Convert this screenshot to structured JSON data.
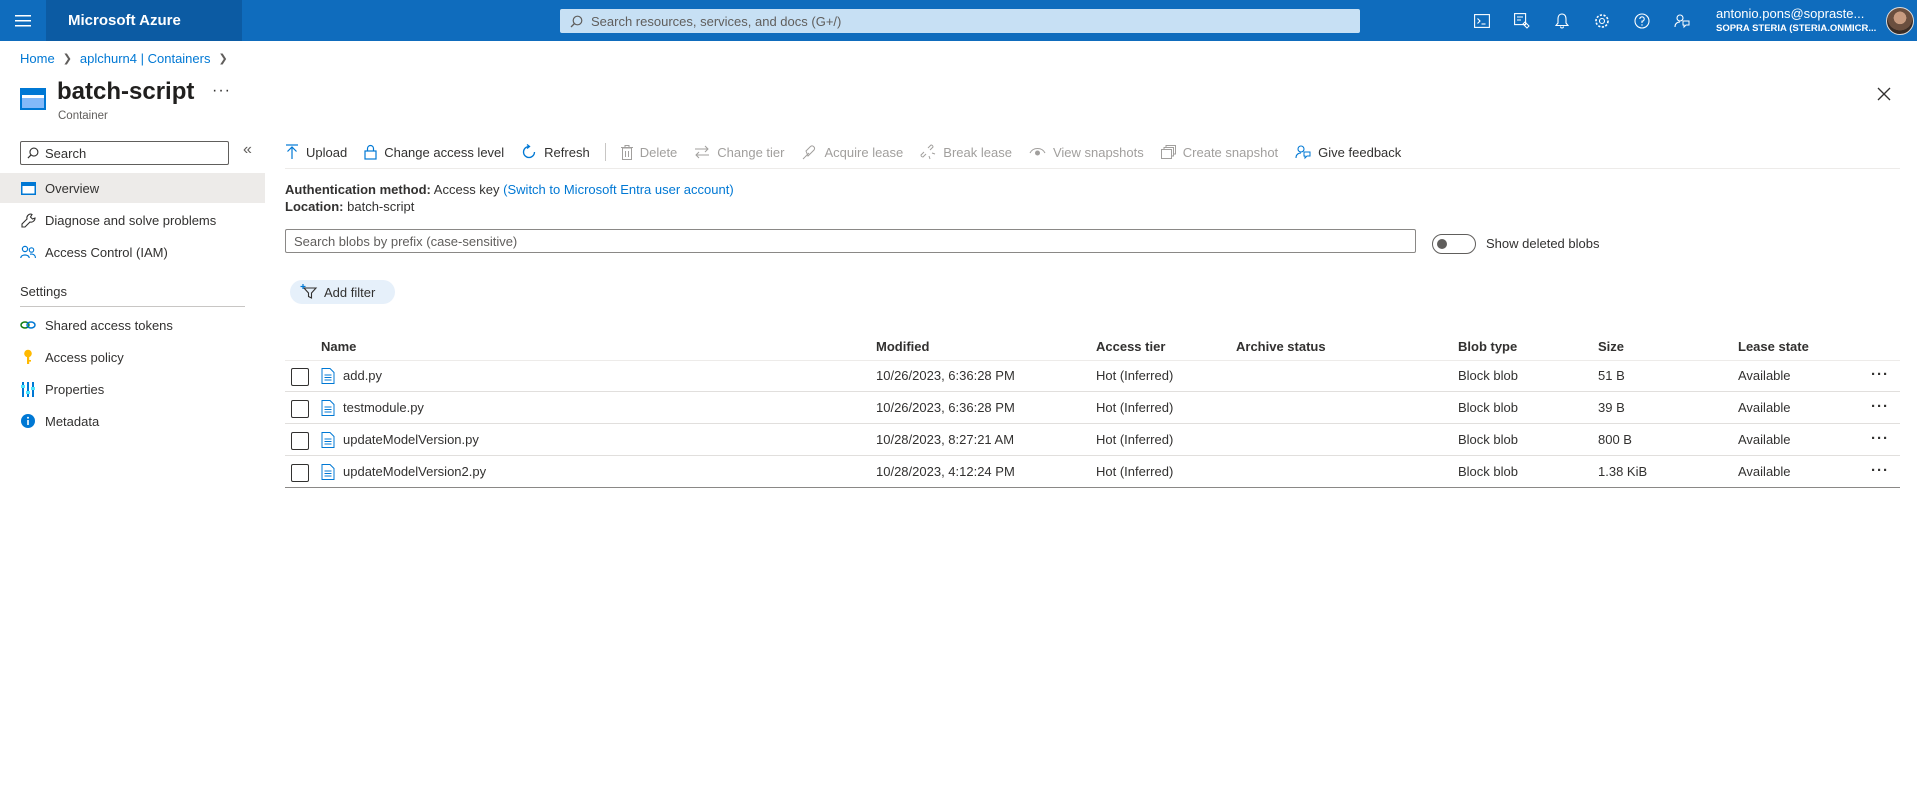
{
  "topbar": {
    "brand": "Microsoft Azure",
    "search_placeholder": "Search resources, services, and docs (G+/)",
    "account_name": "antonio.pons@sopraste...",
    "account_tenant": "SOPRA STERIA (STERIA.ONMICR...",
    "icons": [
      "cloud-shell-icon",
      "directory-subscription-icon",
      "notifications-icon",
      "settings-icon",
      "help-icon",
      "feedback-icon"
    ]
  },
  "breadcrumb": {
    "home": "Home",
    "parent": "aplchurn4 | Containers"
  },
  "page": {
    "title": "batch-script",
    "subtitle": "Container",
    "more": "···"
  },
  "nav": {
    "search_placeholder": "Search",
    "items": [
      {
        "label": "Overview"
      },
      {
        "label": "Diagnose and solve problems"
      },
      {
        "label": "Access Control (IAM)"
      }
    ],
    "settings_header": "Settings",
    "settings_items": [
      {
        "label": "Shared access tokens"
      },
      {
        "label": "Access policy"
      },
      {
        "label": "Properties"
      },
      {
        "label": "Metadata"
      }
    ]
  },
  "commands": {
    "upload": "Upload",
    "change_access": "Change access level",
    "refresh": "Refresh",
    "delete": "Delete",
    "change_tier": "Change tier",
    "acquire_lease": "Acquire lease",
    "break_lease": "Break lease",
    "view_snapshots": "View snapshots",
    "create_snapshot": "Create snapshot",
    "give_feedback": "Give feedback"
  },
  "info": {
    "auth_label": "Authentication method:",
    "auth_value": "Access key",
    "auth_link": "(Switch to Microsoft Entra user account)",
    "location_label": "Location:",
    "location_value": "batch-script"
  },
  "blob_search": {
    "placeholder": "Search blobs by prefix (case-sensitive)"
  },
  "toggle": {
    "label": "Show deleted blobs",
    "on": false
  },
  "add_filter": "Add filter",
  "table": {
    "headers": {
      "name": "Name",
      "modified": "Modified",
      "access_tier": "Access tier",
      "archive_status": "Archive status",
      "blob_type": "Blob type",
      "size": "Size",
      "lease_state": "Lease state"
    },
    "rows": [
      {
        "name": "add.py",
        "modified": "10/26/2023, 6:36:28 PM",
        "tier": "Hot (Inferred)",
        "archive": "",
        "type": "Block blob",
        "size": "51 B",
        "lease": "Available"
      },
      {
        "name": "testmodule.py",
        "modified": "10/26/2023, 6:36:28 PM",
        "tier": "Hot (Inferred)",
        "archive": "",
        "type": "Block blob",
        "size": "39 B",
        "lease": "Available"
      },
      {
        "name": "updateModelVersion.py",
        "modified": "10/28/2023, 8:27:21 AM",
        "tier": "Hot (Inferred)",
        "archive": "",
        "type": "Block blob",
        "size": "800 B",
        "lease": "Available"
      },
      {
        "name": "updateModelVersion2.py",
        "modified": "10/28/2023, 4:12:24 PM",
        "tier": "Hot (Inferred)",
        "archive": "",
        "type": "Block blob",
        "size": "1.38 KiB",
        "lease": "Available"
      }
    ],
    "row_more": "···"
  },
  "colors": {
    "topbar": "#0f6cbd",
    "brand_bg": "#0c5ba3",
    "link": "#0078d4",
    "text": "#323130",
    "disabled": "#a19f9d"
  }
}
